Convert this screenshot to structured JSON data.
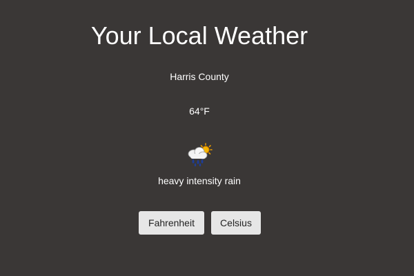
{
  "header": {
    "title": "Your Local Weather"
  },
  "weather": {
    "location": "Harris County",
    "temperature": "64°F",
    "description": "heavy intensity rain",
    "icon": "heavy-rain-sun-icon"
  },
  "units": {
    "fahrenheit_label": "Fahrenheit",
    "celsius_label": "Celsius"
  },
  "colors": {
    "background": "#3a3736",
    "button_bg": "#e6e6e6"
  }
}
